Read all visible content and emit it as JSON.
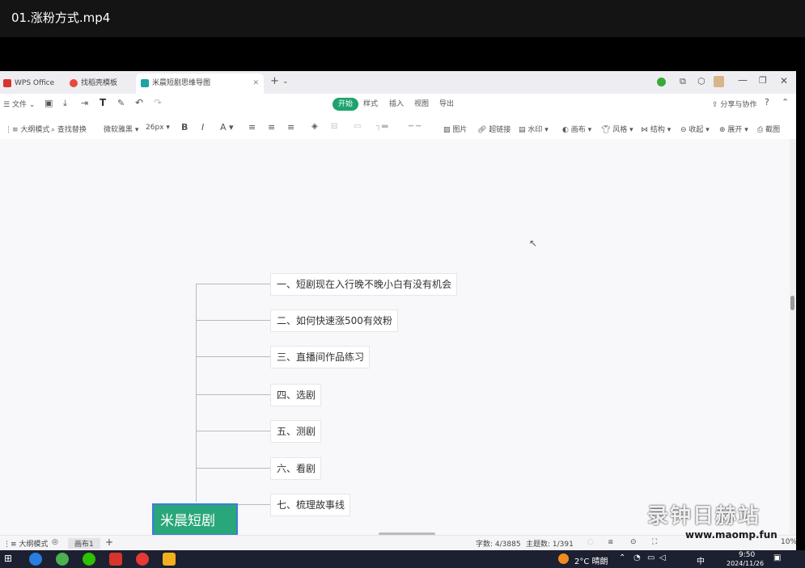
{
  "video": {
    "title": "01.涨粉方式.mp4"
  },
  "tabs": [
    {
      "label": "WPS Office",
      "icon": "wps-logo-icon",
      "color": "#d9342b"
    },
    {
      "label": "找稻壳模板",
      "icon": "docer-icon",
      "color": "#e8473b"
    },
    {
      "label": "米晨短剧思维导图",
      "icon": "mindmap-icon",
      "color": "#1ea3a3"
    }
  ],
  "toolbar1": {
    "file": "文件",
    "ribbon_tabs": [
      "开始",
      "样式",
      "插入",
      "视图",
      "导出"
    ],
    "active_tab": "开始",
    "share": "分享与协作"
  },
  "toolbar2": {
    "outline_mode": "大纲模式",
    "find_replace": "查找替换",
    "font_name": "微软雅黑",
    "font_size": "26px",
    "bold": "B",
    "italic": "I",
    "font_color": "A",
    "image": "图片",
    "hyperlink": "超链接",
    "watermark": "水印",
    "layout": "画布",
    "style": "风格",
    "structure": "结构",
    "collapse": "收起",
    "expand": "展开",
    "screenshot": "截图"
  },
  "mindmap": {
    "root": "米晨短剧",
    "branches": [
      "一、短剧现在入行晚不晚小白有没有机会",
      "二、如何快速涨500有效粉",
      "三、直播间作品练习",
      "四、选剧",
      "五、测剧",
      "六、看剧",
      "七、梳理故事线"
    ]
  },
  "statusbar": {
    "outline": "大纲模式",
    "canvas_tab": "画布1",
    "add": "+",
    "word_count": "字数: 4/3885",
    "topic_count": "主题数: 1/391",
    "zoom": "10%"
  },
  "taskbar": {
    "weather": "2°C 晴朗",
    "ime": "中",
    "time": "9:50",
    "date": "2024/11/26"
  },
  "watermark": {
    "brand": "录钟日赫站",
    "url": "www.maomp.fun"
  },
  "colors": {
    "accent": "#1ea36d",
    "root_fill": "#29a67a",
    "root_border": "#3d7be0"
  }
}
